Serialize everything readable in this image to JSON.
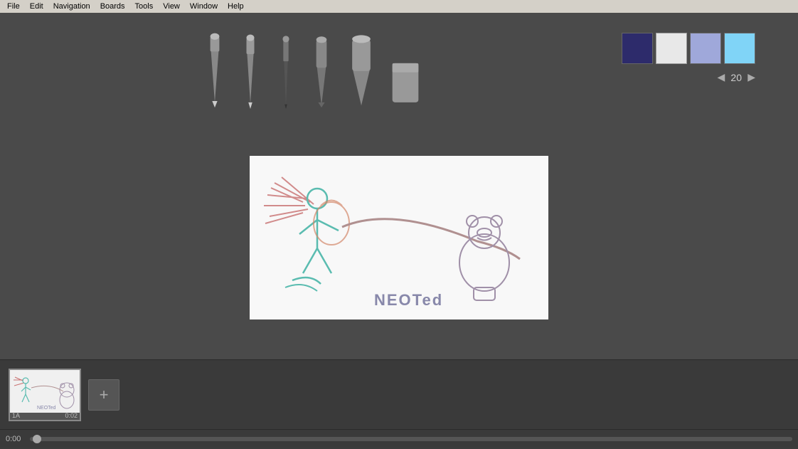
{
  "menubar": {
    "items": [
      "File",
      "Edit",
      "Navigation",
      "Boards",
      "Tools",
      "View",
      "Window",
      "Help"
    ]
  },
  "toolbar": {
    "tools": [
      {
        "name": "pencil-1",
        "label": "Pencil"
      },
      {
        "name": "pencil-2",
        "label": "Pencil 2"
      },
      {
        "name": "pencil-3",
        "label": "Pencil 3"
      },
      {
        "name": "pen",
        "label": "Pen"
      },
      {
        "name": "marker-1",
        "label": "Marker"
      },
      {
        "name": "marker-2",
        "label": "Marker 2"
      },
      {
        "name": "eraser",
        "label": "Eraser"
      }
    ],
    "brush_size": "20",
    "brush_size_label": "20"
  },
  "colors": {
    "swatch1": "#2d2b6b",
    "swatch2": "#e8e8e8",
    "swatch3": "#9fa8da",
    "swatch4": "#80d4f7"
  },
  "timeline": {
    "current_time": "0:00",
    "frames": [
      {
        "id": "1A",
        "time": "0:02"
      }
    ],
    "add_button_label": "+"
  }
}
